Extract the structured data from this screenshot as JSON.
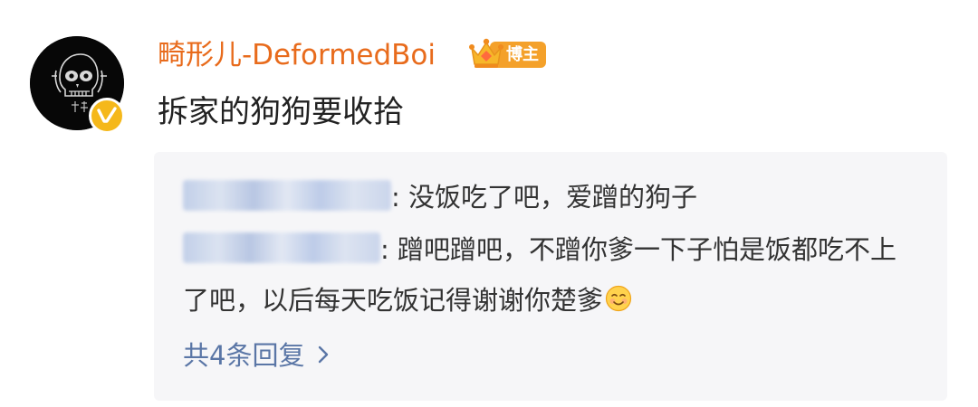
{
  "post": {
    "username": "畸形儿-DeformedBoi",
    "badge_label": "博主",
    "text": "拆家的狗狗要收拾"
  },
  "replies": [
    {
      "separator": ":",
      "text": " 没饭吃了吧，爱蹭的狗子"
    },
    {
      "separator": ":",
      "text": " 蹭吧蹭吧，不蹭你爹一下子怕是饭都吃不上了吧，以后每天吃饭记得谢谢你楚爹"
    }
  ],
  "more_replies_label": "共4条回复",
  "icons": {
    "avatar": "skull-avatar-icon",
    "verified": "verified-badge-icon",
    "crown": "crown-icon",
    "emoji": "smile-emoji-icon",
    "chevron": "chevron-right-icon"
  },
  "colors": {
    "username": "#e86b1c",
    "badge": "#f4a12a",
    "verified": "#f5b81a",
    "link": "#5a76a6",
    "reply_bg": "#f6f6f8"
  }
}
